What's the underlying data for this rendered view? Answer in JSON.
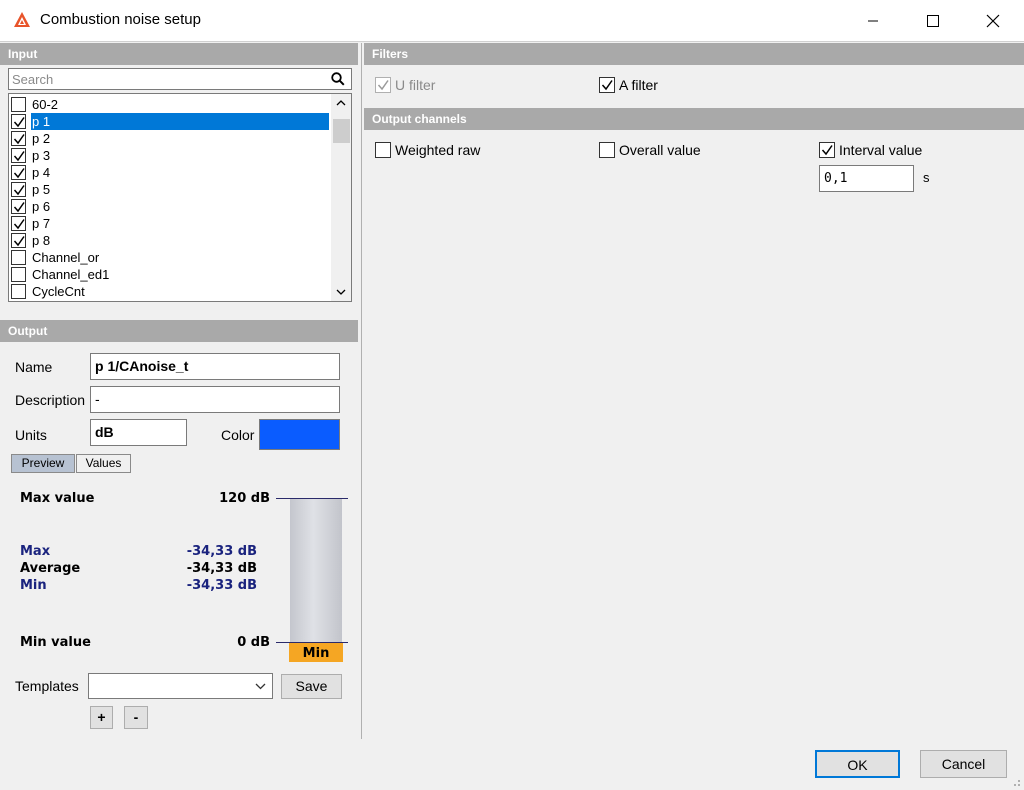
{
  "window": {
    "title": "Combustion noise setup"
  },
  "input": {
    "header": "Input",
    "search_placeholder": "Search",
    "items": [
      {
        "label": "60-2",
        "checked": false,
        "selected": false
      },
      {
        "label": "p 1",
        "checked": true,
        "selected": true
      },
      {
        "label": "p 2",
        "checked": true,
        "selected": false
      },
      {
        "label": "p 3",
        "checked": true,
        "selected": false
      },
      {
        "label": "p 4",
        "checked": true,
        "selected": false
      },
      {
        "label": "p 5",
        "checked": true,
        "selected": false
      },
      {
        "label": "p 6",
        "checked": true,
        "selected": false
      },
      {
        "label": "p 7",
        "checked": true,
        "selected": false
      },
      {
        "label": "p 8",
        "checked": true,
        "selected": false
      },
      {
        "label": "Channel_or",
        "checked": false,
        "selected": false
      },
      {
        "label": "Channel_ed1",
        "checked": false,
        "selected": false
      },
      {
        "label": "CycleCnt",
        "checked": false,
        "selected": false
      }
    ]
  },
  "output": {
    "header": "Output",
    "name_label": "Name",
    "name_value": "p 1/CAnoise_t",
    "description_label": "Description",
    "description_value": "-",
    "units_label": "Units",
    "units_value": "dB",
    "color_label": "Color",
    "color_value": "#0a5cff",
    "tabs": [
      "Preview",
      "Values"
    ],
    "preview": {
      "max_value_label": "Max value",
      "max_value": "120 dB",
      "stats": [
        {
          "label": "Max",
          "value": "-34,33 dB"
        },
        {
          "label": "Average",
          "value": "-34,33 dB"
        },
        {
          "label": "Min",
          "value": "-34,33 dB"
        }
      ],
      "min_value_label": "Min value",
      "min_value": "0 dB",
      "gauge_label": "Min",
      "gauge_accent": "#f5a623"
    },
    "templates_label": "Templates",
    "templates_value": "",
    "save_label": "Save",
    "add_label": "+",
    "remove_label": "-"
  },
  "filters": {
    "header": "Filters",
    "u_filter": {
      "label": "U filter",
      "checked": true,
      "disabled": true
    },
    "a_filter": {
      "label": "A filter",
      "checked": true
    }
  },
  "output_channels": {
    "header": "Output channels",
    "weighted_raw": {
      "label": "Weighted raw",
      "checked": false
    },
    "overall_value": {
      "label": "Overall value",
      "checked": false
    },
    "interval_value": {
      "label": "Interval value",
      "checked": true
    },
    "interval_input": "0,1",
    "interval_unit": "s"
  },
  "footer": {
    "ok_label": "OK",
    "cancel_label": "Cancel"
  }
}
